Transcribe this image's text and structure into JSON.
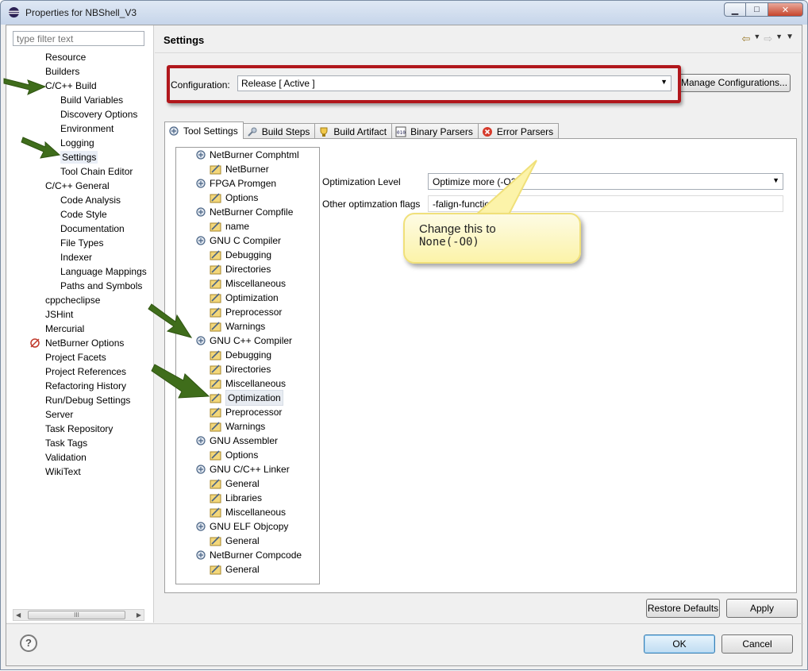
{
  "window": {
    "title": "Properties for NBShell_V3",
    "minimize_glyph": "▁",
    "maximize_glyph": "□",
    "close_glyph": "✕"
  },
  "filter": {
    "placeholder": "type filter text"
  },
  "nav": {
    "items": [
      {
        "label": "Resource",
        "level": 0
      },
      {
        "label": "Builders",
        "level": 0
      },
      {
        "label": "C/C++ Build",
        "level": 0
      },
      {
        "label": "Build Variables",
        "level": 1
      },
      {
        "label": "Discovery Options",
        "level": 1
      },
      {
        "label": "Environment",
        "level": 1
      },
      {
        "label": "Logging",
        "level": 1
      },
      {
        "label": "Settings",
        "level": 1,
        "selected": true
      },
      {
        "label": "Tool Chain Editor",
        "level": 1
      },
      {
        "label": "C/C++ General",
        "level": 0
      },
      {
        "label": "Code Analysis",
        "level": 1
      },
      {
        "label": "Code Style",
        "level": 1
      },
      {
        "label": "Documentation",
        "level": 1
      },
      {
        "label": "File Types",
        "level": 1
      },
      {
        "label": "Indexer",
        "level": 1
      },
      {
        "label": "Language Mappings",
        "level": 1
      },
      {
        "label": "Paths and Symbols",
        "level": 1
      },
      {
        "label": "cppcheclipse",
        "level": 0
      },
      {
        "label": "JSHint",
        "level": 0
      },
      {
        "label": "Mercurial",
        "level": 0
      },
      {
        "label": "NetBurner Options",
        "level": 0,
        "icon": "netburner-icon"
      },
      {
        "label": "Project Facets",
        "level": 0
      },
      {
        "label": "Project References",
        "level": 0
      },
      {
        "label": "Refactoring History",
        "level": 0
      },
      {
        "label": "Run/Debug Settings",
        "level": 0
      },
      {
        "label": "Server",
        "level": 0
      },
      {
        "label": "Task Repository",
        "level": 0
      },
      {
        "label": "Task Tags",
        "level": 0
      },
      {
        "label": "Validation",
        "level": 0
      },
      {
        "label": "WikiText",
        "level": 0
      }
    ],
    "scroll_grip": "III"
  },
  "page": {
    "title": "Settings"
  },
  "configuration": {
    "label": "Configuration:",
    "value": "Release  [ Active ]",
    "manage_button": "Manage Configurations..."
  },
  "tabs": [
    {
      "label": "Tool Settings",
      "icon": "gear-icon",
      "active": true
    },
    {
      "label": "Build Steps",
      "icon": "build-steps-icon"
    },
    {
      "label": "Build Artifact",
      "icon": "artifact-icon"
    },
    {
      "label": "Binary Parsers",
      "icon": "binary-icon"
    },
    {
      "label": "Error Parsers",
      "icon": "error-icon"
    }
  ],
  "tool_tree": [
    {
      "label": "NetBurner Comphtml",
      "level": 0
    },
    {
      "label": "NetBurner",
      "level": 1
    },
    {
      "label": "FPGA Promgen",
      "level": 0
    },
    {
      "label": "Options",
      "level": 1
    },
    {
      "label": "NetBurner Compfile",
      "level": 0
    },
    {
      "label": "name",
      "level": 1
    },
    {
      "label": "GNU C Compiler",
      "level": 0
    },
    {
      "label": "Debugging",
      "level": 1
    },
    {
      "label": "Directories",
      "level": 1
    },
    {
      "label": "Miscellaneous",
      "level": 1
    },
    {
      "label": "Optimization",
      "level": 1
    },
    {
      "label": "Preprocessor",
      "level": 1
    },
    {
      "label": "Warnings",
      "level": 1
    },
    {
      "label": "GNU C++ Compiler",
      "level": 0
    },
    {
      "label": "Debugging",
      "level": 1
    },
    {
      "label": "Directories",
      "level": 1
    },
    {
      "label": "Miscellaneous",
      "level": 1
    },
    {
      "label": "Optimization",
      "level": 1,
      "selected": true
    },
    {
      "label": "Preprocessor",
      "level": 1
    },
    {
      "label": "Warnings",
      "level": 1
    },
    {
      "label": "GNU Assembler",
      "level": 0
    },
    {
      "label": "Options",
      "level": 1
    },
    {
      "label": "GNU C/C++ Linker",
      "level": 0
    },
    {
      "label": "General",
      "level": 1
    },
    {
      "label": "Libraries",
      "level": 1
    },
    {
      "label": "Miscellaneous",
      "level": 1
    },
    {
      "label": "GNU ELF Objcopy",
      "level": 0
    },
    {
      "label": "General",
      "level": 1
    },
    {
      "label": "NetBurner Compcode",
      "level": 0
    },
    {
      "label": "General",
      "level": 1
    }
  ],
  "options": {
    "optimization_level_label": "Optimization Level",
    "optimization_level_value": "Optimize more (-O2)",
    "other_flags_label": "Other optimzation flags",
    "other_flags_value": "-falign-functions=4"
  },
  "callout": {
    "line1": "Change this to",
    "line2": "None(-O0)"
  },
  "buttons": {
    "restore_defaults": "Restore Defaults",
    "apply": "Apply",
    "ok": "OK",
    "cancel": "Cancel",
    "help": "?"
  },
  "colors": {
    "highlight_box": "#b1171c",
    "annotation_arrow": "#3f6d1b",
    "callout_fill": "#fcf3a9"
  }
}
